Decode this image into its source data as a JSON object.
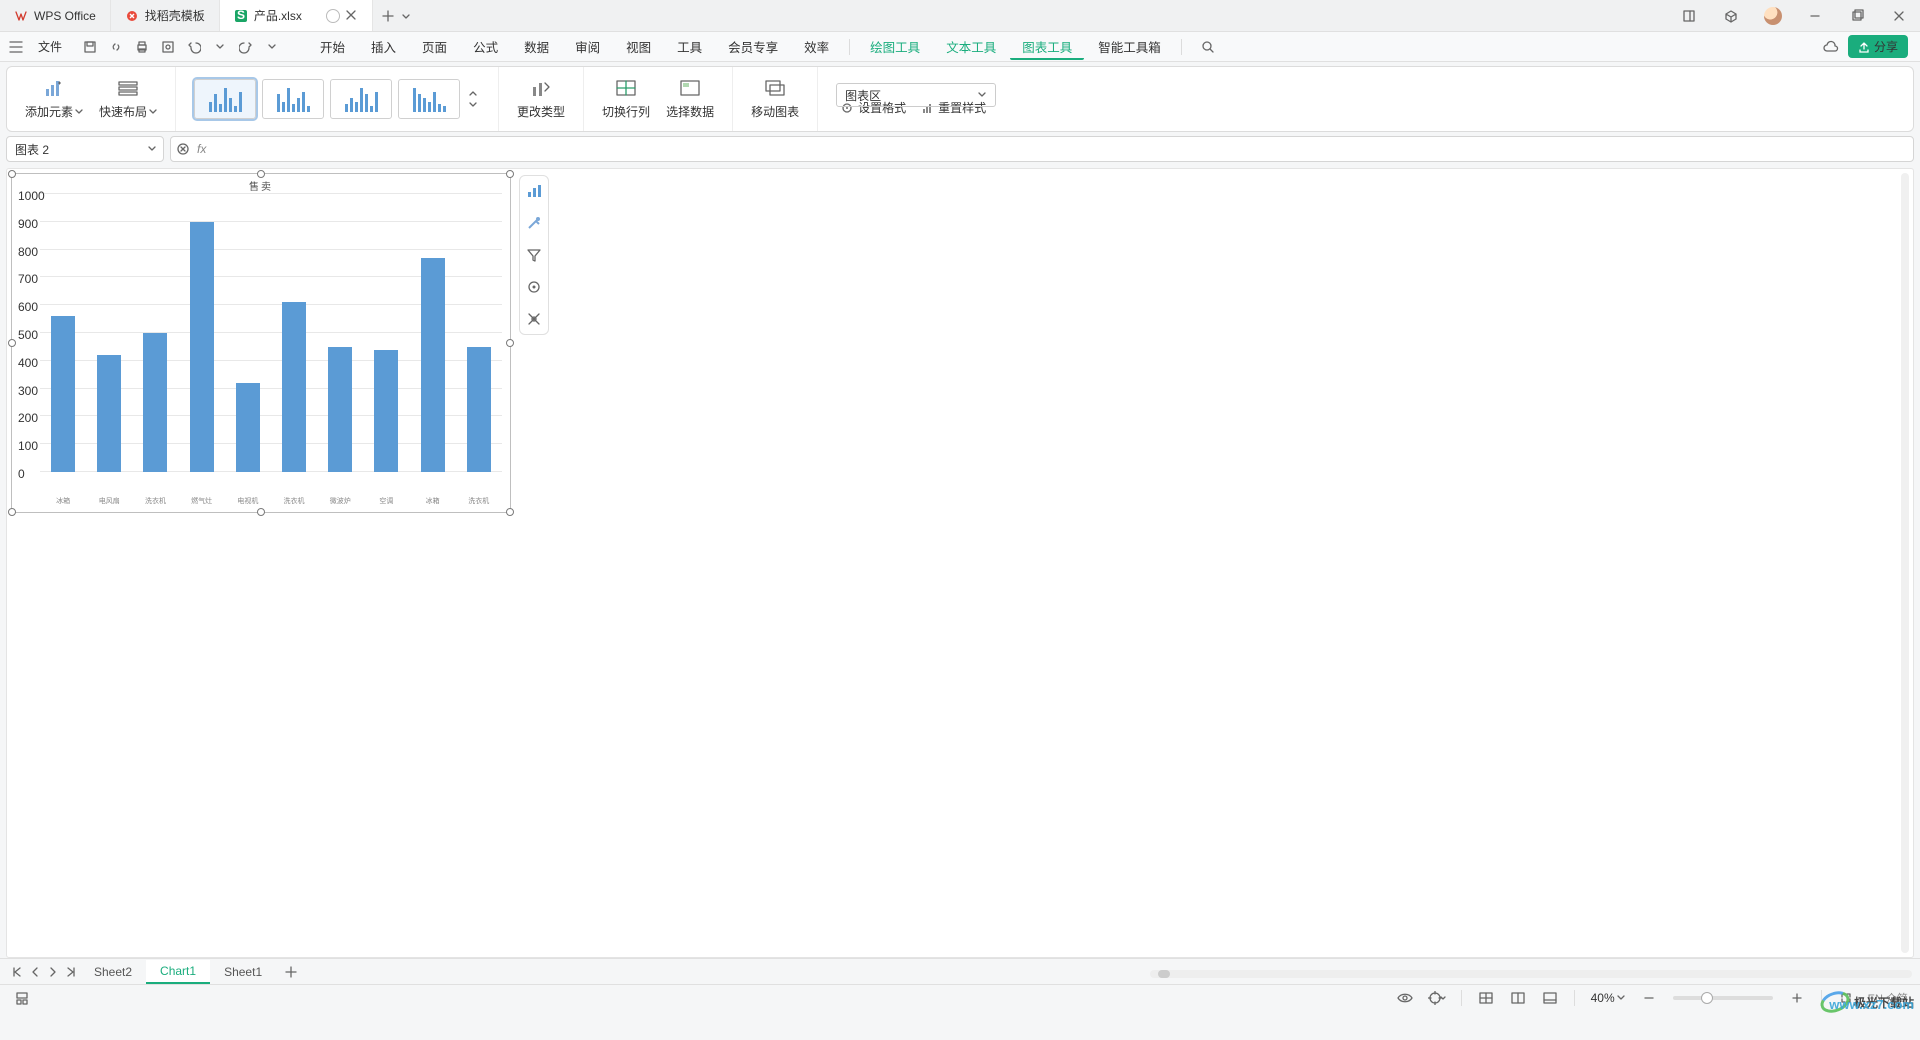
{
  "titlebar": {
    "tabs": [
      {
        "label": "WPS Office",
        "icon": "wps"
      },
      {
        "label": "找稻壳模板",
        "icon": "docer"
      },
      {
        "label": "产品.xlsx",
        "icon": "sheet",
        "active": true
      }
    ]
  },
  "menubar": {
    "file": "文件",
    "items": [
      "开始",
      "插入",
      "页面",
      "公式",
      "数据",
      "审阅",
      "视图",
      "工具",
      "会员专享",
      "效率"
    ],
    "context_items": [
      "绘图工具",
      "文本工具",
      "图表工具",
      "智能工具箱"
    ],
    "active_context": "图表工具",
    "share": "分享"
  },
  "ribbon": {
    "add_element": "添加元素",
    "quick_layout": "快速布局",
    "change_type": "更改类型",
    "switch_rowcol": "切换行列",
    "select_data": "选择数据",
    "move_chart": "移动图表",
    "area_select": "图表区",
    "set_format": "设置格式",
    "reset_style": "重置样式"
  },
  "namebox": "图表 2",
  "chart_data": {
    "type": "bar",
    "title": "售卖",
    "categories": [
      "冰箱",
      "电风扇",
      "洗衣机",
      "燃气灶",
      "电视机",
      "洗衣机",
      "微波炉",
      "空调",
      "冰箱",
      "洗衣机"
    ],
    "values": [
      560,
      420,
      500,
      900,
      320,
      610,
      450,
      440,
      770,
      450
    ],
    "ylim": [
      0,
      1000
    ],
    "yticks": [
      0,
      100,
      200,
      300,
      400,
      500,
      600,
      700,
      800,
      900,
      1000
    ]
  },
  "sheets": {
    "list": [
      "Sheet2",
      "Chart1",
      "Sheet1"
    ],
    "active": "Chart1"
  },
  "status": {
    "zoom": "40%",
    "ime": "EN 众简"
  },
  "watermark": {
    "main": "极光下载站",
    "sub": "www.xz7.com"
  }
}
